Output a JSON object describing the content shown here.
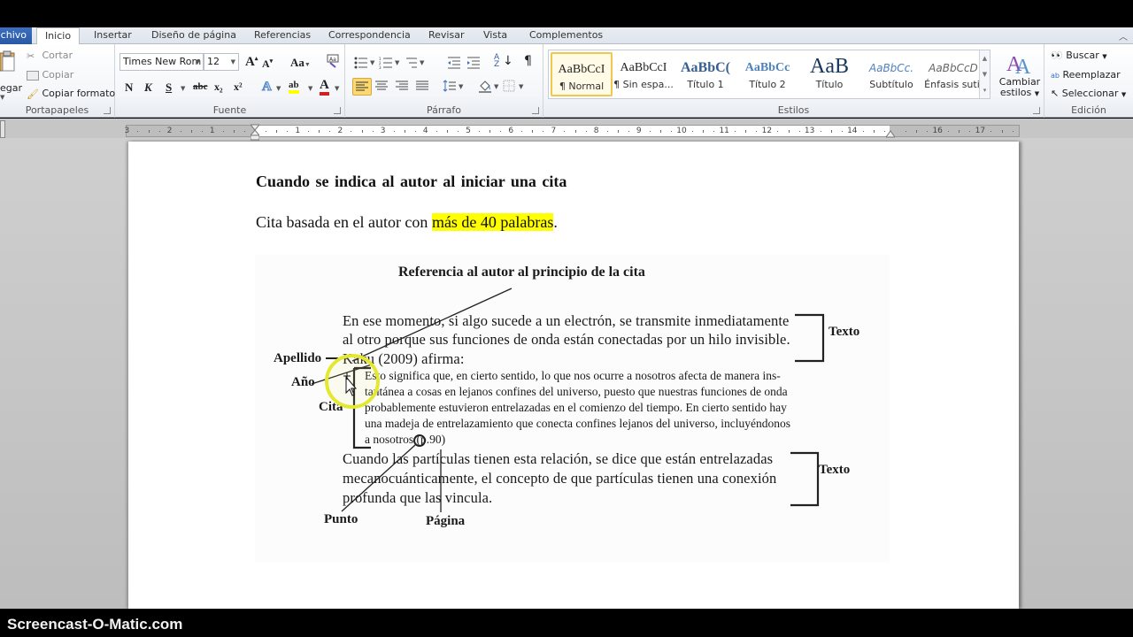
{
  "app": {
    "tabs": [
      "chivo",
      "Inicio",
      "Insertar",
      "Diseño de página",
      "Referencias",
      "Correspondencia",
      "Revisar",
      "Vista",
      "Complementos"
    ],
    "active_tab": "Inicio"
  },
  "ribbon": {
    "clipboard": {
      "paste_label": "egar",
      "cut": "Cortar",
      "copy": "Copiar",
      "format_painter": "Copiar formato",
      "group_label": "Portapapeles"
    },
    "font": {
      "font_name": "Times New Rom",
      "font_size": "12",
      "grow": "A",
      "shrink": "A",
      "change_case": "Aa",
      "bold": "N",
      "italic": "K",
      "underline": "S",
      "strike": "abc",
      "subscript": "x₂",
      "superscript": "x²",
      "text_effects": "A",
      "highlight": "ab",
      "font_color": "A",
      "group_label": "Fuente"
    },
    "paragraph": {
      "pilcrow": "¶",
      "sort": "A↓",
      "group_label": "Párrafo"
    },
    "styles": {
      "items": [
        {
          "sample": "AaBbCcI",
          "name": "¶ Normal",
          "selected": true
        },
        {
          "sample": "AaBbCcI",
          "name": "¶ Sin espa...",
          "selected": false
        },
        {
          "sample": "AaBbC(",
          "name": "Título 1",
          "selected": false
        },
        {
          "sample": "AaBbCc",
          "name": "Título 2",
          "selected": false
        },
        {
          "sample": "AaB",
          "name": "Título",
          "selected": false
        },
        {
          "sample": "AaBbCc.",
          "name": "Subtítulo",
          "selected": false
        },
        {
          "sample": "AaBbCcD",
          "name": "Énfasis sutil",
          "selected": false
        }
      ],
      "change_styles": "Cambiar estilos",
      "change_styles_line1": "Cambiar",
      "change_styles_line2": "estilos",
      "group_label": "Estilos"
    },
    "editing": {
      "find": "Buscar",
      "replace": "Reemplazar",
      "select": "Seleccionar",
      "group_label": "Edición"
    }
  },
  "ruler": {
    "left_numbers": [
      "3",
      "2",
      "1"
    ],
    "right_numbers": [
      "1",
      "2",
      "3",
      "4",
      "5",
      "6",
      "7",
      "8",
      "9",
      "10",
      "11",
      "12",
      "13",
      "14",
      "16",
      "17"
    ]
  },
  "document": {
    "heading": "Cuando se indica al autor al iniciar una cita",
    "line_prefix": "Cita basada en el autor con ",
    "line_highlight": "más de 40 palabras",
    "line_suffix": ".",
    "highlight_color": "#ffff00"
  },
  "figure": {
    "title": "Referencia al autor al principio de la cita",
    "intro_lines": [
      "En ese momento, si algo sucede a un electrón, se transmite inmediatamente",
      "al otro porque sus funciones de onda están conectadas por un hilo invisible."
    ],
    "author_line": "Kaku (2009) afirma:",
    "quote_lines": [
      "Esto significa que, en cierto sentido, lo que nos ocurre a nosotros afecta de manera ins-",
      "tantánea a cosas en lejanos confines del universo, puesto que nuestras funciones de onda",
      "probablemente estuvieron entrelazadas en el comienzo del tiempo. En cierto sentido hay",
      "una madeja de entrelazamiento que conecta confines lejanos del universo, incluyéndonos",
      "a nosotros (p.90)"
    ],
    "outro_lines": [
      "Cuando las partículas tienen esta relación, se dice que están entrelazadas",
      "mecanocuánticamente, el concepto de que partículas tienen una conexión",
      "profunda que las vincula."
    ],
    "labels": {
      "apellido": "Apellido",
      "anio": "Año",
      "cita": "Cita",
      "texto_top": "Texto",
      "texto_bottom": "Texto",
      "punto": "Punto",
      "pagina": "Página"
    }
  },
  "watermark": "Screencast-O-Matic.com"
}
